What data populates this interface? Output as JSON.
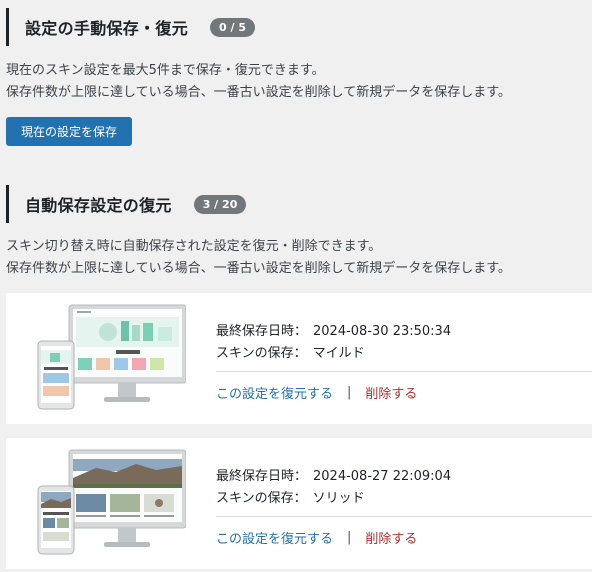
{
  "manual": {
    "title": "設定の手動保存・復元",
    "badge": "0 / 5",
    "desc1": "現在のスキン設定を最大5件まで保存・復元できます。",
    "desc2": "保存件数が上限に達している場合、一番古い設定を削除して新規データを保存します。",
    "save_button": "現在の設定を保存"
  },
  "auto": {
    "title": "自動保存設定の復元",
    "badge": "3 / 20",
    "desc1": "スキン切り替え時に自動保存された設定を復元・削除できます。",
    "desc2": "保存件数が上限に達している場合、一番古い設定を削除して新規データを保存します。"
  },
  "entries": [
    {
      "date_label": "最終保存日時：",
      "date": "2024-08-30 23:50:34",
      "skin_label": "スキンの保存：",
      "skin": "マイルド",
      "restore": "この設定を復元する",
      "sep": "|",
      "delete": "削除する"
    },
    {
      "date_label": "最終保存日時：",
      "date": "2024-08-27 22:09:04",
      "skin_label": "スキンの保存：",
      "skin": "ソリッド",
      "restore": "この設定を復元する",
      "sep": "|",
      "delete": "削除する"
    }
  ],
  "colors": {
    "accent": "#2271b1",
    "danger": "#b32d2e",
    "badge": "#72777c",
    "background": "#f0f0f1"
  }
}
